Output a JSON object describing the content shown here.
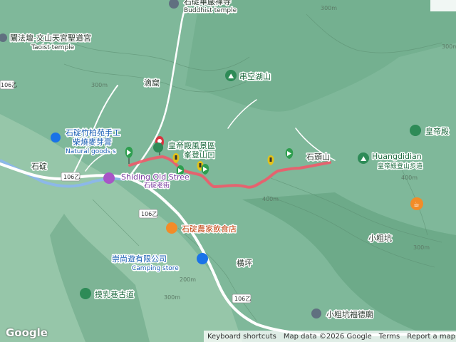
{
  "places": {
    "shihding_buddhist_temple": "石碇華嚴禪寺",
    "buddhist_temple_en": "Buddhist temple",
    "taoist_temple": "闡法壇-文山天宮聖道宮",
    "taoist_temple_en": "Taoist temple",
    "dizhai": "滴窟",
    "chuankonghu": "串空湖山",
    "bamboo_shop_line1": "石碇竹柏苑手工",
    "bamboo_shop_line2": "柴燒麥芽膏",
    "bamboo_shop_en": "Natural goods s",
    "shiding": "石碇",
    "huangdi_scenic_line1": "皇帝殿風景區",
    "huangdi_scenic_line2": "峯登山口",
    "old_street_en": "Shiding Old Stree",
    "old_street_zh": "石碇老街",
    "shitoushan": "石頭山",
    "huangdidian_en": "Huangdidian",
    "huangdidian_trail": "皇帝殿登山步道",
    "huangdidian_short": "皇帝殿",
    "restaurant": "石碇農家飲食店",
    "xiaocukeng": "小粗坑",
    "camping_shop": "崇尚遊有限公司",
    "camping_en": "Camping store",
    "hengping": "橫坪",
    "moru_trail": "摸乳巷古道",
    "xiaocukeng_temple": "小粗坑福德廟"
  },
  "roads": {
    "route_106_1": "106乙",
    "route_106_2": "106乙",
    "route_106_3": "106乙",
    "route_106_4": "106乙"
  },
  "contours": [
    "300m",
    "300m",
    "400m",
    "400m",
    "300m",
    "300m",
    "200m",
    "300m"
  ],
  "footer": {
    "shortcuts": "Keyboard shortcuts",
    "map_data": "Map data ©2026 Google",
    "terms": "Terms",
    "report": "Report a map error"
  },
  "logo": "Google",
  "colors": {
    "track": "#f05a6a",
    "pin_green": "#2e9e4f",
    "pin_red": "#d9343f",
    "pin_yellow": "#e3c21a",
    "terrain": "#7fb89a",
    "road": "#ffffff",
    "river": "#8ab4f8"
  }
}
